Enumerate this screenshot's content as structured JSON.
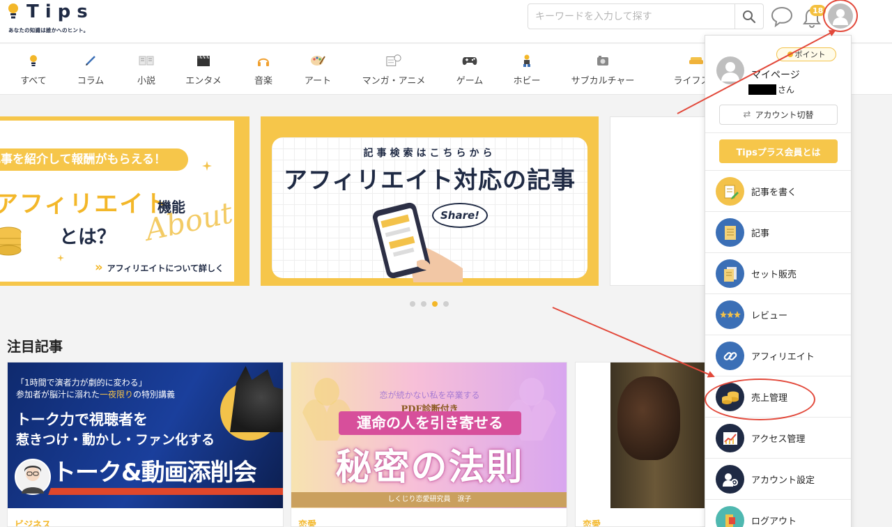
{
  "header": {
    "logo_text": "Tips",
    "logo_tagline": "あなたの知識は誰かへのヒント。",
    "search_placeholder": "キーワードを入力して探す",
    "notification_count": "18"
  },
  "categories": [
    {
      "label": "すべて",
      "icon": "lightbulb-icon"
    },
    {
      "label": "コラム",
      "icon": "pen-icon"
    },
    {
      "label": "小説",
      "icon": "book-icon"
    },
    {
      "label": "エンタメ",
      "icon": "clapperboard-icon"
    },
    {
      "label": "音楽",
      "icon": "headphones-icon"
    },
    {
      "label": "アート",
      "icon": "palette-icon"
    },
    {
      "label": "マンガ・アニメ",
      "icon": "manga-icon"
    },
    {
      "label": "ゲーム",
      "icon": "gamepad-icon"
    },
    {
      "label": "ホビー",
      "icon": "hobby-icon"
    },
    {
      "label": "サブカルチャー",
      "icon": "camera-icon"
    },
    {
      "label": "ライフスタ",
      "icon": "sofa-icon"
    }
  ],
  "banners": {
    "b1": {
      "stripe": "記事を紹介して報酬がもらえる！",
      "main": "アフィリエイト",
      "kino": "機能",
      "toha": "とは？",
      "about": "About",
      "link": "アフィリエイトについて詳しく"
    },
    "b2": {
      "sub": "記事検索はこちらから",
      "title": "アフィリエイト対応の記事",
      "share": "Share!"
    }
  },
  "carousel": {
    "count": 4,
    "active": 2
  },
  "featured": {
    "title": "注目記事",
    "cards": [
      {
        "category": "ビジネス",
        "line1": "「1時間で演者力が劇的に変わる」",
        "line2_pre": "参加者が脳汁に溺れた",
        "line2_hl": "一夜限り",
        "line2_post": "の特別講義",
        "line3": "トーク力で視聴者を",
        "line4": "惹きつけ・動かし・ファン化する",
        "line5": "トーク&動画添削会"
      },
      {
        "category": "恋愛",
        "top": "恋が続かない私を卒業する",
        "pdf": "PDF診断付き",
        "ribbon": "運命の人を引き寄せる",
        "big": "秘密の法則",
        "foot": "しくじり恋愛研究員　涙子"
      },
      {
        "category": "恋愛"
      }
    ]
  },
  "menu": {
    "point_label": "ポイント",
    "mypage": "マイページ",
    "username_suffix": "さん",
    "account_switch": "アカウント切替",
    "plus_button": "Tipsプラス会員とは",
    "items": [
      {
        "label": "記事を書く",
        "icon": "write-article-icon",
        "color": "#f3c24a"
      },
      {
        "label": "記事",
        "icon": "article-icon",
        "color": "#3b6fb6"
      },
      {
        "label": "セット販売",
        "icon": "set-sale-icon",
        "color": "#3b6fb6"
      },
      {
        "label": "レビュー",
        "icon": "review-stars-icon",
        "color": "#3b6fb6"
      },
      {
        "label": "アフィリエイト",
        "icon": "link-icon",
        "color": "#3b6fb6"
      },
      {
        "label": "売上管理",
        "icon": "coins-icon",
        "color": "#1f2a44"
      },
      {
        "label": "アクセス管理",
        "icon": "chart-icon",
        "color": "#1f2a44"
      },
      {
        "label": "アカウント設定",
        "icon": "user-gear-icon",
        "color": "#1f2a44"
      },
      {
        "label": "ログアウト",
        "icon": "logout-icon",
        "color": "#4fb8b0"
      }
    ]
  }
}
